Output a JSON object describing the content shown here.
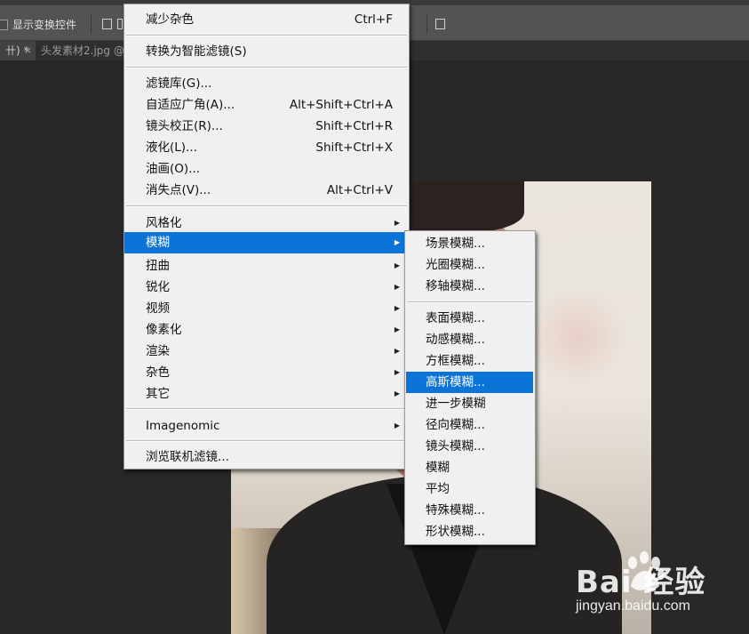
{
  "optbar": {
    "show_transform_label": "显示变换控件"
  },
  "tabs": [
    {
      "label": "卄) *"
    },
    {
      "label": "头发素材2.jpg @"
    }
  ],
  "filter_menu": {
    "items": [
      {
        "label": "减少杂色",
        "shortcut": "Ctrl+F"
      },
      {
        "label": "转换为智能滤镜(S)",
        "shortcut": ""
      },
      {
        "label": "滤镜库(G)...",
        "shortcut": ""
      },
      {
        "label": "自适应广角(A)...",
        "shortcut": "Alt+Shift+Ctrl+A"
      },
      {
        "label": "镜头校正(R)...",
        "shortcut": "Shift+Ctrl+R"
      },
      {
        "label": "液化(L)...",
        "shortcut": "Shift+Ctrl+X"
      },
      {
        "label": "油画(O)...",
        "shortcut": ""
      },
      {
        "label": "消失点(V)...",
        "shortcut": "Alt+Ctrl+V"
      },
      {
        "label": "风格化",
        "shortcut": ""
      },
      {
        "label": "模糊",
        "shortcut": ""
      },
      {
        "label": "扭曲",
        "shortcut": ""
      },
      {
        "label": "锐化",
        "shortcut": ""
      },
      {
        "label": "视频",
        "shortcut": ""
      },
      {
        "label": "像素化",
        "shortcut": ""
      },
      {
        "label": "渲染",
        "shortcut": ""
      },
      {
        "label": "杂色",
        "shortcut": ""
      },
      {
        "label": "其它",
        "shortcut": ""
      },
      {
        "label": "Imagenomic",
        "shortcut": ""
      },
      {
        "label": "浏览联机滤镜...",
        "shortcut": ""
      }
    ],
    "highlighted": "模糊"
  },
  "blur_submenu": {
    "items": [
      {
        "label": "场景模糊..."
      },
      {
        "label": "光圈模糊..."
      },
      {
        "label": "移轴模糊..."
      },
      {
        "label": "表面模糊..."
      },
      {
        "label": "动感模糊..."
      },
      {
        "label": "方框模糊..."
      },
      {
        "label": "高斯模糊..."
      },
      {
        "label": "进一步模糊"
      },
      {
        "label": "径向模糊..."
      },
      {
        "label": "镜头模糊..."
      },
      {
        "label": "模糊"
      },
      {
        "label": "平均"
      },
      {
        "label": "特殊模糊..."
      },
      {
        "label": "形状模糊..."
      }
    ],
    "highlighted": "高斯模糊..."
  },
  "watermark": {
    "brand": "Bai  经验",
    "url": "jingyan.baidu.com"
  },
  "colors": {
    "highlight": "#0b74d6",
    "menu_bg": "#f0f0f0",
    "workspace_bg": "#282828"
  }
}
